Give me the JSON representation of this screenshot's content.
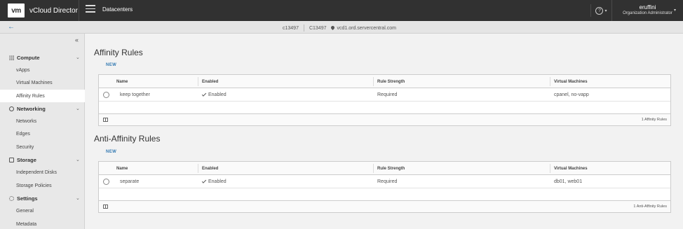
{
  "header": {
    "logo_text": "vm",
    "app_title": "vCloud Director",
    "nav_title": "Datacenters",
    "help_icon": "?",
    "user_name": "eruffini",
    "user_role": "Organization Administrator"
  },
  "subheader": {
    "org_short": "c13497",
    "org_name": "C13497",
    "location": "vcd1.ord.servercentral.com"
  },
  "sidebar": {
    "sections": [
      {
        "label": "Compute",
        "icon": "grid-icon",
        "items": [
          "vApps",
          "Virtual Machines",
          "Affinity Rules"
        ]
      },
      {
        "label": "Networking",
        "icon": "globe-icon",
        "items": [
          "Networks",
          "Edges",
          "Security"
        ]
      },
      {
        "label": "Storage",
        "icon": "disk-icon",
        "items": [
          "Independent Disks",
          "Storage Policies"
        ]
      },
      {
        "label": "Settings",
        "icon": "gear-icon",
        "items": [
          "General",
          "Metadata"
        ]
      }
    ],
    "active_item": "Affinity Rules"
  },
  "affinity": {
    "title": "Affinity Rules",
    "new_label": "NEW",
    "columns": [
      "Name",
      "Enabled",
      "Rule Strength",
      "Virtual Machines"
    ],
    "rows": [
      {
        "name": "keep together",
        "enabled": "Enabled",
        "strength": "Required",
        "vms": "cpanel, no-vapp"
      }
    ],
    "footer": "1 Affinity Rules"
  },
  "anti_affinity": {
    "title": "Anti-Affinity Rules",
    "new_label": "NEW",
    "columns": [
      "Name",
      "Enabled",
      "Rule Strength",
      "Virtual Machines"
    ],
    "rows": [
      {
        "name": "separate",
        "enabled": "Enabled",
        "strength": "Required",
        "vms": "db01, web01"
      }
    ],
    "footer": "1 Anti-Affinity Rules"
  },
  "colors": {
    "header_bg": "#313131",
    "link": "#3279b2",
    "sidebar_bg": "#e8e8e8",
    "main_bg": "#f2f2f2"
  }
}
